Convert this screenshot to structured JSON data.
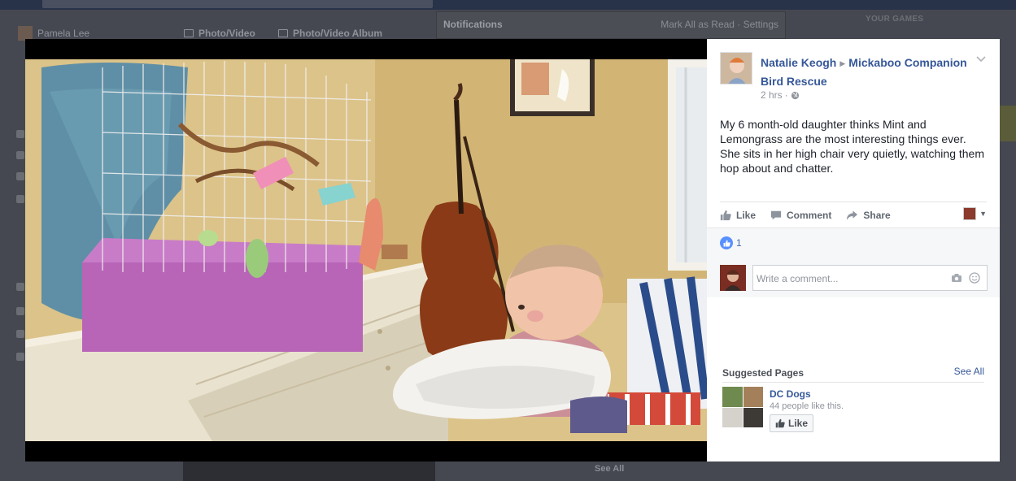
{
  "background": {
    "user_name": "Pamela Lee",
    "tabs": [
      "Photo/Video",
      "Photo/Video Album"
    ],
    "notifications_title": "Notifications",
    "notifications_links": "Mark All as Read · Settings",
    "games_label": "YOUR GAMES",
    "see_all": "See All"
  },
  "post": {
    "author": "Natalie Keogh",
    "target_page": "Mickaboo Companion Bird Rescue",
    "time": "2 hrs",
    "privacy_icon": "globe-icon",
    "text": "My 6 month-old daughter thinks Mint and Lemongrass are the most interesting things ever. She sits in her high chair very quietly, watching them hop about and chatter."
  },
  "actions": {
    "like": "Like",
    "comment": "Comment",
    "share": "Share"
  },
  "feedback": {
    "like_count": "1",
    "comment_placeholder": "Write a comment..."
  },
  "suggested": {
    "title": "Suggested Pages",
    "see_all": "See All",
    "page": {
      "name": "DC Dogs",
      "likes_text": "44 people like this.",
      "like_button": "Like"
    }
  },
  "colors": {
    "link_blue": "#365899",
    "like_blue": "#5890ff",
    "lightbox_bg": "#000000"
  }
}
